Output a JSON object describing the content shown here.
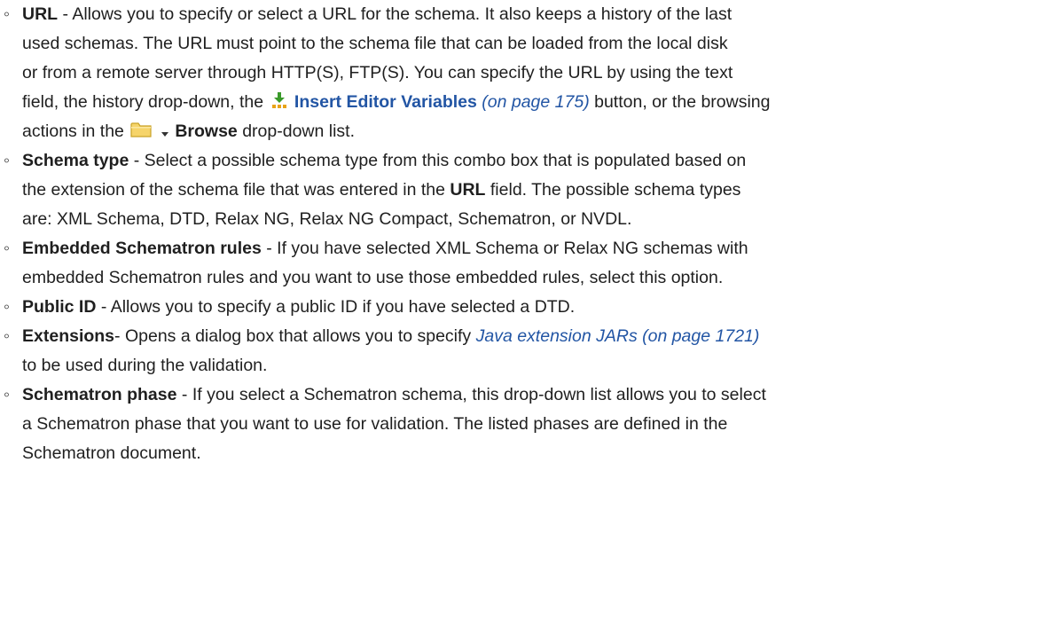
{
  "bullet_glyph": "◦",
  "items": {
    "url": {
      "term": "URL",
      "text1": " - Allows you to specify or select a URL for the schema. It also keeps a history of the last",
      "text2": "used schemas. The URL must point to the schema file that can be loaded from the local disk",
      "text3": "or from a remote server through HTTP(S), FTP(S). You can specify the URL by using the text",
      "text4a": "field, the history drop-down, the ",
      "insert_link": "Insert Editor Variables",
      "insert_ref": "(on page 175)",
      "text4b": " button, or the browsing",
      "text5a": "actions in the ",
      "browse_label": "Browse",
      "text5b": " drop-down list."
    },
    "schema_type": {
      "term": "Schema type",
      "text1": " - Select a possible schema type from this combo box that is populated based on",
      "text2a": "the extension of the schema file that was entered in the ",
      "url_term": "URL",
      "text2b": " field. The possible schema types",
      "text3": "are: XML Schema, DTD, Relax NG, Relax NG Compact, Schematron, or NVDL."
    },
    "embedded": {
      "term": "Embedded Schematron rules",
      "text1": " - If you have selected XML Schema or Relax NG schemas with",
      "text2": "embedded Schematron rules and you want to use those embedded rules, select this option."
    },
    "public_id": {
      "term": "Public ID",
      "text1": " - Allows you to specify a public ID if you have selected a DTD."
    },
    "extensions": {
      "term": "Extensions",
      "text1": "- Opens a dialog box that allows you to specify ",
      "jars_link": "Java extension JARs (on page 1721)",
      "text2": "to be used during the validation."
    },
    "phase": {
      "term": "Schematron phase",
      "text1": " - If you select a Schematron schema, this drop-down list allows you to select",
      "text2": "a Schematron phase that you want to use for validation. The listed phases are defined in the",
      "text3": "Schematron document."
    }
  }
}
